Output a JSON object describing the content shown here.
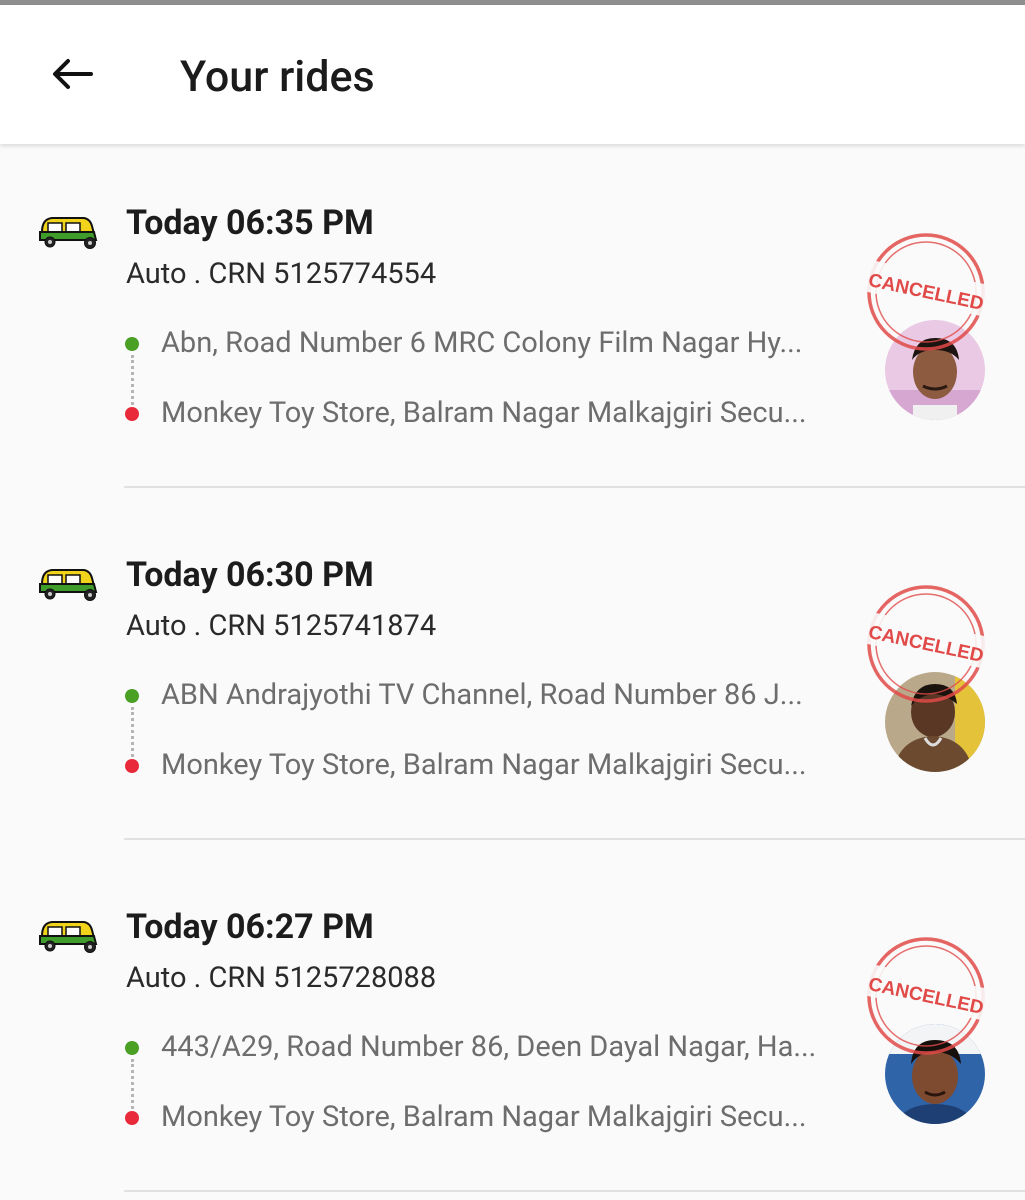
{
  "header": {
    "title": "Your rides",
    "back_icon": "back-arrow-icon"
  },
  "rides": [
    {
      "time": "Today 06:35 PM",
      "crn": "Auto . CRN 5125774554",
      "pickup": "Abn, Road Number 6 MRC Colony Film Nagar Hy...",
      "drop": "Monkey Toy Store, Balram Nagar Malkajgiri Secu...",
      "status": "CANCELLED",
      "vehicle_icon": "auto-rickshaw-icon"
    },
    {
      "time": "Today 06:30 PM",
      "crn": "Auto . CRN 5125741874",
      "pickup": "ABN Andrajyothi TV Channel, Road Number 86 J...",
      "drop": "Monkey Toy Store, Balram Nagar Malkajgiri Secu...",
      "status": "CANCELLED",
      "vehicle_icon": "auto-rickshaw-icon"
    },
    {
      "time": "Today 06:27 PM",
      "crn": "Auto . CRN 5125728088",
      "pickup": "443/A29, Road Number 86, Deen Dayal Nagar, Ha...",
      "drop": "Monkey Toy Store, Balram Nagar Malkajgiri Secu...",
      "status": "CANCELLED",
      "vehicle_icon": "auto-rickshaw-icon"
    }
  ],
  "colors": {
    "pickup_dot": "#4a9f25",
    "drop_dot": "#e82a3a",
    "stamp": "#e04a48",
    "auto_body": "#f2d31b",
    "auto_base": "#3f9b2a"
  }
}
